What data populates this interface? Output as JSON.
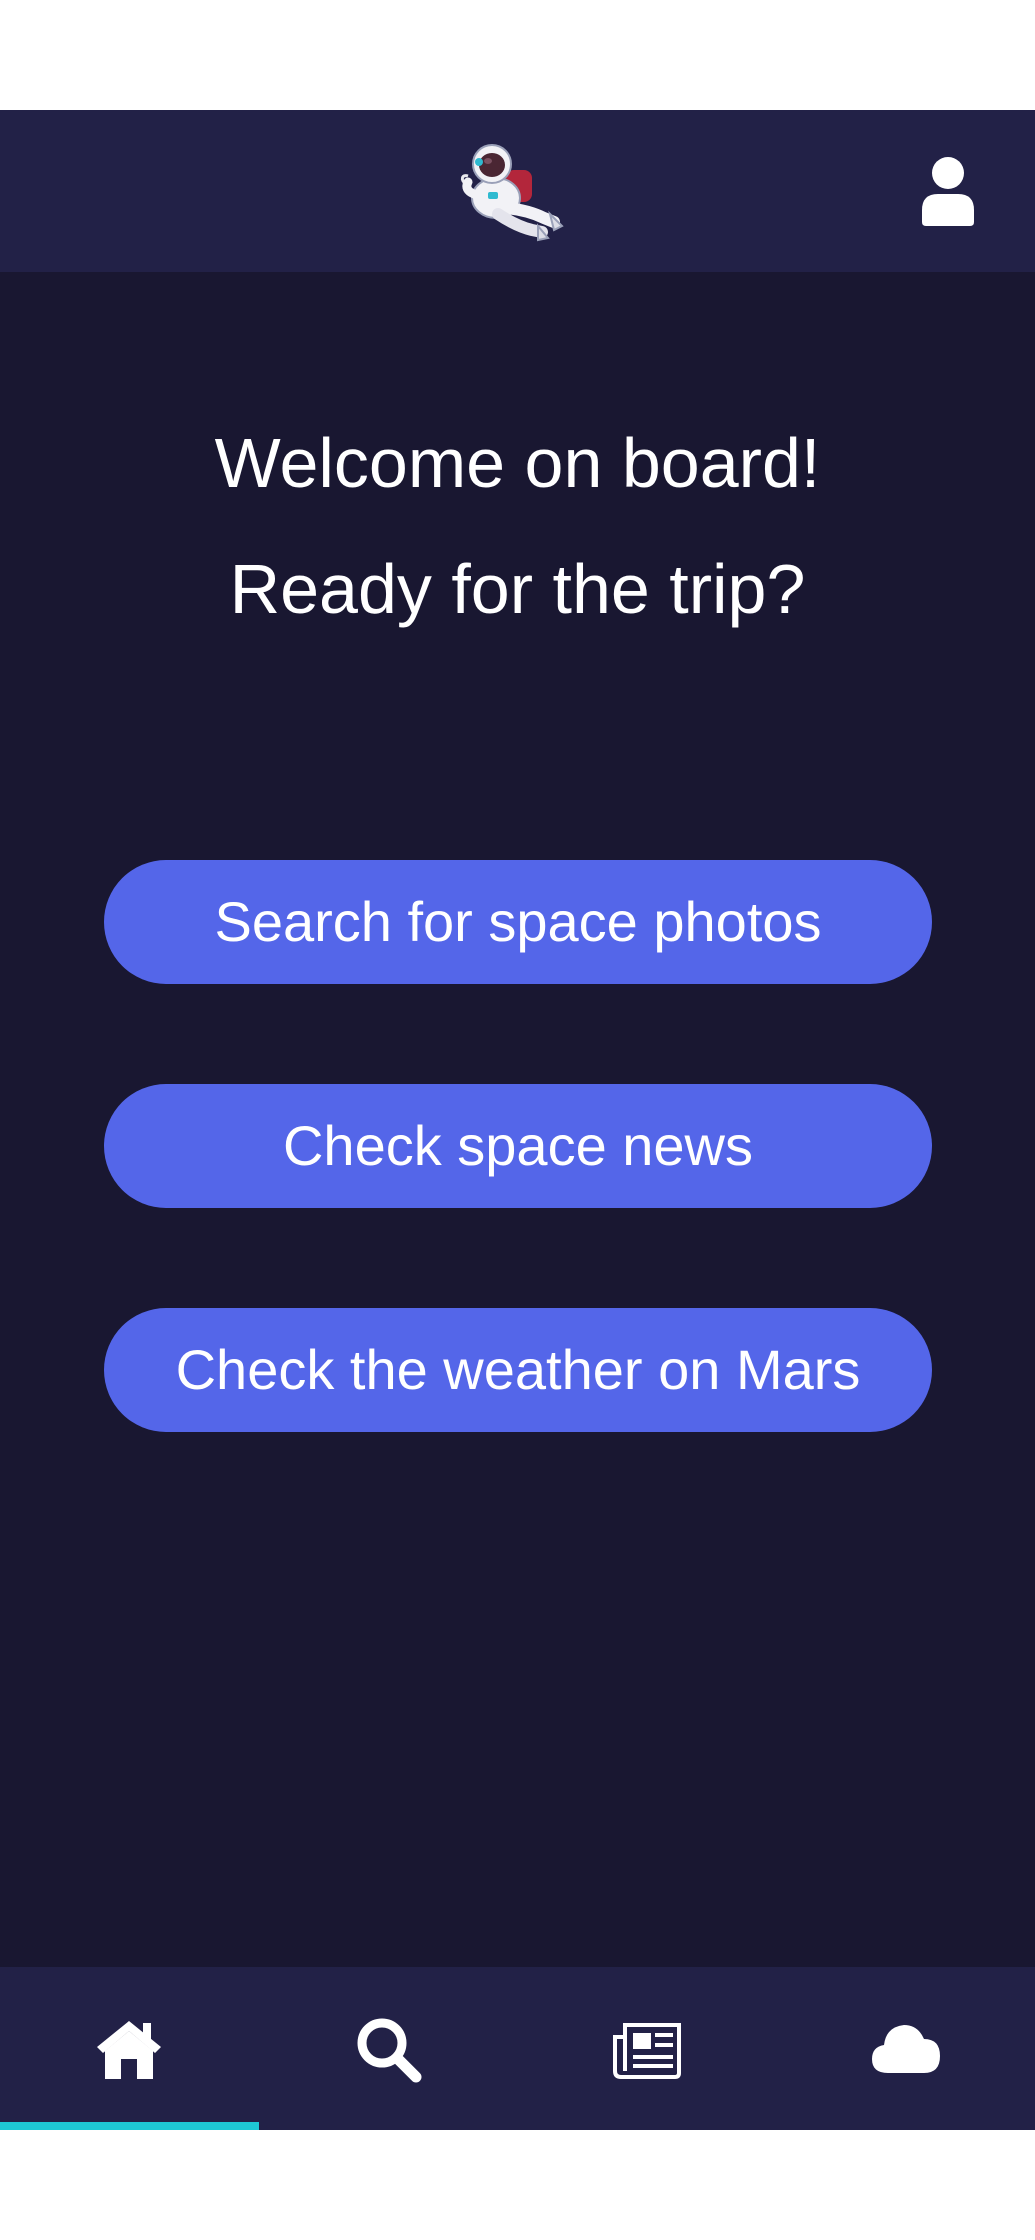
{
  "header": {
    "logo_icon": "astronaut-logo",
    "user_icon": "user-icon"
  },
  "welcome": {
    "line1": "Welcome on board!",
    "line2": "Ready for the trip?"
  },
  "actions": [
    {
      "label": "Search for space photos"
    },
    {
      "label": "Check space news"
    },
    {
      "label": "Check the weather on Mars"
    }
  ],
  "nav": {
    "active": "home",
    "items": [
      {
        "id": "home",
        "icon": "home-icon"
      },
      {
        "id": "search",
        "icon": "search-icon"
      },
      {
        "id": "news",
        "icon": "newspaper-icon"
      },
      {
        "id": "weather",
        "icon": "cloud-icon"
      }
    ]
  },
  "colors": {
    "background": "#191731",
    "bar": "#222147",
    "button": "#5466e9",
    "active_indicator": "#1ec8d5",
    "text": "#ffffff"
  }
}
